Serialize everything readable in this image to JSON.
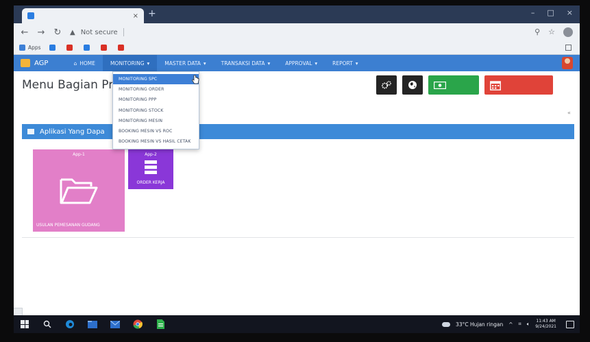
{
  "browser": {
    "tab_title": "",
    "tab_close": "×",
    "new_tab": "+",
    "window_controls": [
      "–",
      "□",
      "×"
    ],
    "address": {
      "security_label": "Not secure",
      "url": ""
    },
    "bookmarks": [
      {
        "label": "Apps",
        "color": "#3d7fd6"
      },
      {
        "label": "",
        "color": "#2a7de1"
      },
      {
        "label": "",
        "color": "#d93025"
      },
      {
        "label": "",
        "color": "#2a7de1"
      },
      {
        "label": "",
        "color": "#d93025"
      },
      {
        "label": "",
        "color": "#d93025"
      }
    ],
    "reading_list": ""
  },
  "navbar": {
    "brand": "AGP",
    "items": [
      {
        "label": "HOME",
        "icon": "home-icon"
      },
      {
        "label": "MONITORING",
        "caret": true,
        "active": true
      },
      {
        "label": "MASTER DATA",
        "caret": true
      },
      {
        "label": "TRANSAKSI DATA",
        "caret": true
      },
      {
        "label": "APPROVAL",
        "caret": true
      },
      {
        "label": "REPORT",
        "caret": true
      }
    ],
    "user_name": ""
  },
  "dropdown": {
    "items": [
      "MONITORING SPC",
      "MONITORING ORDER",
      "MONITORING PPP",
      "MONITORING STOCK",
      "MONITORING MESIN",
      "BOOKING MESIN VS ROC",
      "BOOKING MESIN VS HASIL CETAK"
    ],
    "highlighted_index": 0
  },
  "page": {
    "title": "Menu Bagian Pr",
    "breadcrumb": "",
    "stat_green": {
      "value": "",
      "label": ""
    },
    "stat_red": {
      "value": "",
      "label": ""
    },
    "collapse_glyph": "«",
    "panel_title": "Aplikasi Yang Dapa",
    "apps": [
      {
        "number": "App-1",
        "label": "USULAN PEMESANAN GUDANG",
        "color": "#e27fc8",
        "icon": "folder-open-icon"
      },
      {
        "number": "App-2",
        "label": "ORDER KERJA",
        "color": "#8a37d8",
        "icon": "list-icon"
      }
    ]
  },
  "status_url": "",
  "taskbar": {
    "pinned": [
      "search-icon",
      "edge-icon",
      "file-explorer-icon",
      "mail-icon",
      "chrome-icon",
      "document-icon"
    ],
    "weather": "33°C  Hujan ringan",
    "tray_glyphs": "^",
    "time": "11:43 AM",
    "date": "9/24/2021"
  }
}
